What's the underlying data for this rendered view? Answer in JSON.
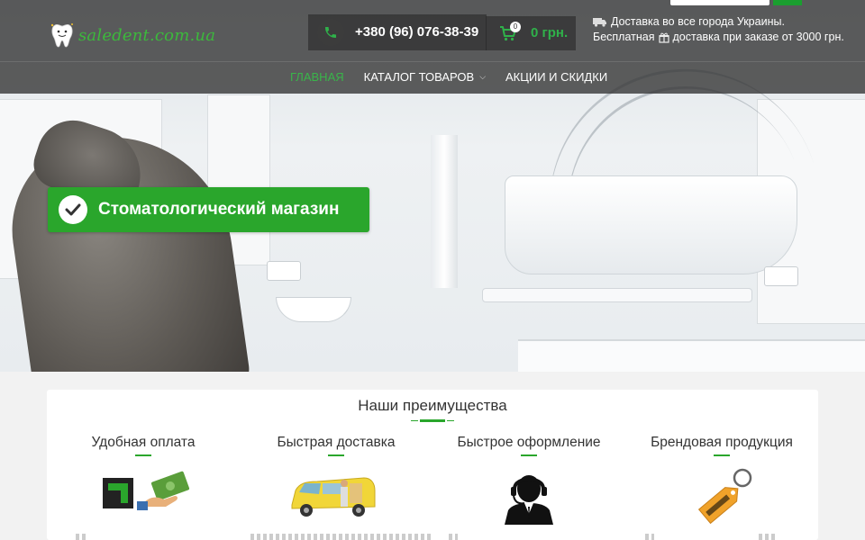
{
  "header": {
    "logo_text": "saledent.com.ua",
    "phone": "+380 (96) 076-38-39",
    "cart_count": "0",
    "cart_total": "0 грн.",
    "delivery_line1": "Доставка во все города Украины.",
    "delivery_line2": "Бесплатная",
    "delivery_line2_rest": "доставка при заказе от 3000 грн."
  },
  "nav": {
    "items": [
      {
        "label": "ГЛАВНАЯ"
      },
      {
        "label": "КАТАЛОГ ТОВАРОВ"
      },
      {
        "label": "АКЦИИ И СКИДКИ"
      }
    ]
  },
  "banner": {
    "text": "Стоматологический магазин"
  },
  "advantages": {
    "title": "Наши преимущества",
    "items": [
      {
        "label": "Удобная оплата",
        "icon": "payment-icon"
      },
      {
        "label": "Быстрая доставка",
        "icon": "delivery-van-icon"
      },
      {
        "label": "Быстрое оформление",
        "icon": "operator-headset-icon"
      },
      {
        "label": "Брендовая продукция",
        "icon": "brand-tag-icon"
      }
    ]
  },
  "colors": {
    "accent": "#2aa62c",
    "header_bg": "#333333",
    "cart_total": "#2fb14a"
  }
}
